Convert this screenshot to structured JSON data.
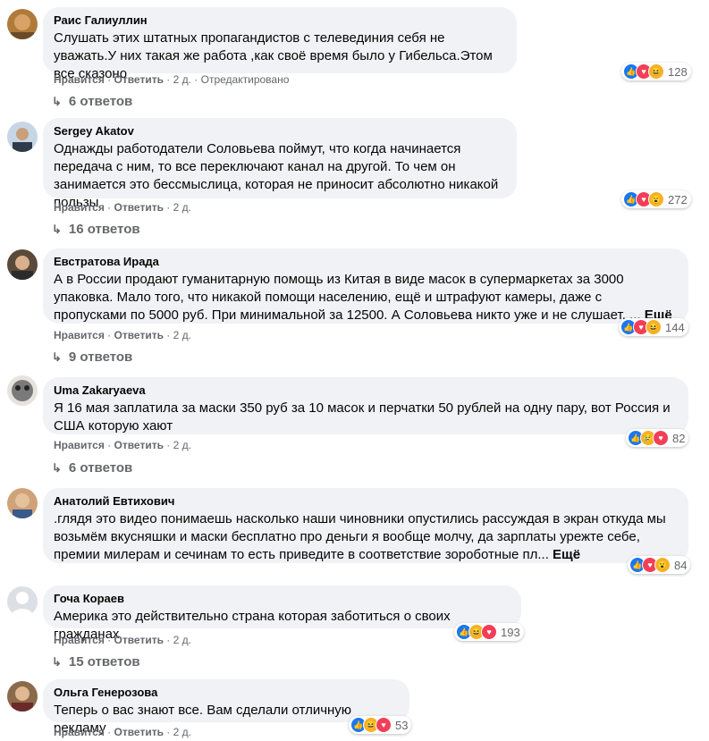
{
  "ui": {
    "like": "Нравится",
    "reply": "Ответить",
    "more": "Ещё",
    "edited": "Отредактировано"
  },
  "comments": [
    {
      "author": "Раис Галиуллин",
      "text": "Слушать этих штатных пропагандистов с телевединия себя не уважать.У них такая же работа ,как своё время было у Гибельса.Этом все сказоно",
      "time": "2 д.",
      "count": "128",
      "replies": "6 ответов"
    },
    {
      "author": "Sergey Akatov",
      "text": "Однажды работодатели Соловьева поймут, что когда начинается передача с ним, то все переключают канал на другой. То чем он занимается это бессмыслица, которая не приносит абсолютно никакой пользы",
      "time": "2 д.",
      "count": "272",
      "replies": "16 ответов"
    },
    {
      "author": "Евстратова Ирада",
      "text": "А в России продают гуманитарную помощь из Китая в виде масок в супермаркетах за 3000 упаковка. Мало того, что никакой помощи населению, ещё и штрафуют камеры, даже с пропусками по 5000 руб. При минимальной за 12500. А Соловьева никто уже и не слушает, ...",
      "time": "2 д.",
      "count": "144",
      "replies": "9 ответов"
    },
    {
      "author": "Uma Zakaryaeva",
      "text": "Я 16 мая заплатила за маски 350 руб за 10 масок и перчатки 50 рублей на одну пару, вот Россия и США которую хают",
      "time": "2 д.",
      "count": "82",
      "replies": "6 ответов"
    },
    {
      "author": "Анатолий Евтихович",
      "text": ".глядя это видео понимаешь насколько наши чиновники опустились рассуждая в экран откуда мы возьмём вкусняшки и маски бесплатно про деньги я вообще молчу, да зарплаты урежте себе, премии милерам и сечинам то есть приведите в соответствие зороботные пл...",
      "time": "2 д.",
      "count": "84",
      "replies": ""
    },
    {
      "author": "Гоча Кораев",
      "text": "Америка это действительно страна которая заботиться о своих гражданах",
      "time": "2 д.",
      "count": "193",
      "replies": "15 ответов"
    },
    {
      "author": "Ольга Генерозова",
      "text": "Теперь о вас знают все. Вам сделали отличную рекламу",
      "time": "2 д.",
      "count": "53",
      "replies": ""
    }
  ],
  "colors": {
    "bubble": "#f0f2f5",
    "like": "#1877f2",
    "love": "#f33e58",
    "yellow": "#f7b125",
    "meta": "#65676b"
  }
}
